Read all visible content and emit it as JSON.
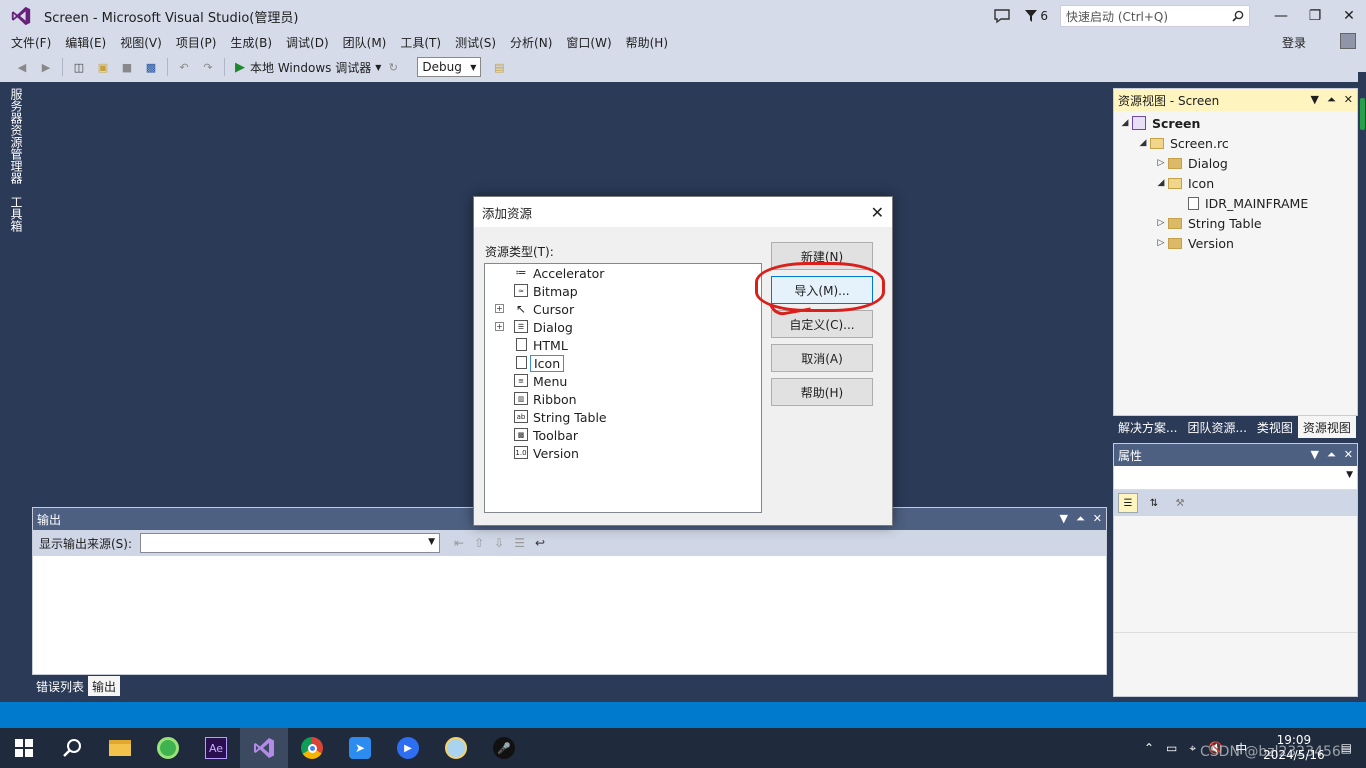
{
  "window": {
    "title": "Screen - Microsoft Visual Studio(管理员)",
    "notification_count": "6",
    "quick_launch_placeholder": "快速启动 (Ctrl+Q)",
    "login": "登录"
  },
  "menu": [
    "文件(F)",
    "编辑(E)",
    "视图(V)",
    "项目(P)",
    "生成(B)",
    "调试(D)",
    "团队(M)",
    "工具(T)",
    "测试(S)",
    "分析(N)",
    "窗口(W)",
    "帮助(H)"
  ],
  "toolbar": {
    "run_label": "本地 Windows 调试器",
    "config": "Debug"
  },
  "left_tabs": [
    "服务器资源管理器",
    "工具箱"
  ],
  "resource_view": {
    "title": "资源视图 - Screen",
    "tree": {
      "project": "Screen",
      "rc": "Screen.rc",
      "dialog": "Dialog",
      "icon": "Icon",
      "icon_child": "IDR_MAINFRAME",
      "string_table": "String Table",
      "version": "Version"
    },
    "tabs": [
      "解决方案...",
      "团队资源...",
      "类视图",
      "资源视图"
    ]
  },
  "properties": {
    "title": "属性"
  },
  "output": {
    "title": "输出",
    "source_label": "显示输出来源(S):",
    "tabs": [
      "错误列表",
      "输出"
    ]
  },
  "dialog": {
    "title": "添加资源",
    "list_label": "资源类型(T):",
    "items": [
      "Accelerator",
      "Bitmap",
      "Cursor",
      "Dialog",
      "HTML",
      "Icon",
      "Menu",
      "Ribbon",
      "String Table",
      "Toolbar",
      "Version"
    ],
    "buttons": {
      "new": "新建(N)",
      "import": "导入(M)...",
      "custom": "自定义(C)...",
      "cancel": "取消(A)",
      "help": "帮助(H)"
    }
  },
  "taskbar": {
    "time": "19:09",
    "date": "2024/5/16",
    "ime": "中",
    "watermark": "CSDN @bzl2323456"
  }
}
